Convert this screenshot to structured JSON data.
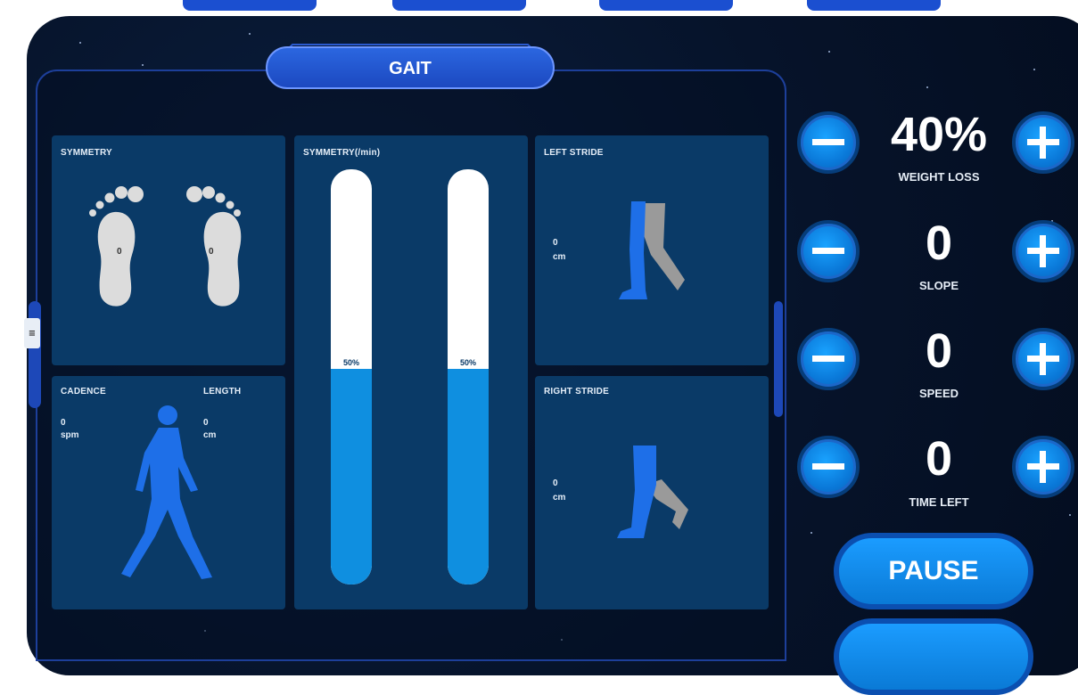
{
  "panel": {
    "title": "GAIT",
    "side_tab": "≡"
  },
  "cards": {
    "symmetry": {
      "label": "SYMMETRY",
      "left_foot_value": "0",
      "right_foot_value": "0"
    },
    "symmetry_rate": {
      "label": "SYMMETRY(/min)",
      "left_bar": {
        "percent_label": "50%",
        "fill_fraction": 0.52
      },
      "right_bar": {
        "percent_label": "50%",
        "fill_fraction": 0.52
      }
    },
    "left_stride": {
      "label": "LEFT STRIDE",
      "value": "0",
      "unit": "cm"
    },
    "right_stride": {
      "label": "RIGHT STRIDE",
      "value": "0",
      "unit": "cm"
    },
    "cadence_length": {
      "cadence_label": "CADENCE",
      "cadence_value": "0",
      "cadence_unit": "spm",
      "length_label": "LENGTH",
      "length_value": "0",
      "length_unit": "cm"
    }
  },
  "controls": {
    "weight_loss": {
      "value": "40%",
      "label": "WEIGHT LOSS"
    },
    "slope": {
      "value": "0",
      "label": "SLOPE"
    },
    "speed": {
      "value": "0",
      "label": "SPEED"
    },
    "time_left": {
      "value": "0",
      "label": "TIME LEFT"
    }
  },
  "buttons": {
    "pause": "PAUSE"
  },
  "colors": {
    "background": "#06132a",
    "card": "#0a3a67",
    "accent": "#0f8fe0",
    "title_pill": "#2b66e0",
    "stride_gray": "#9a9a9a"
  }
}
